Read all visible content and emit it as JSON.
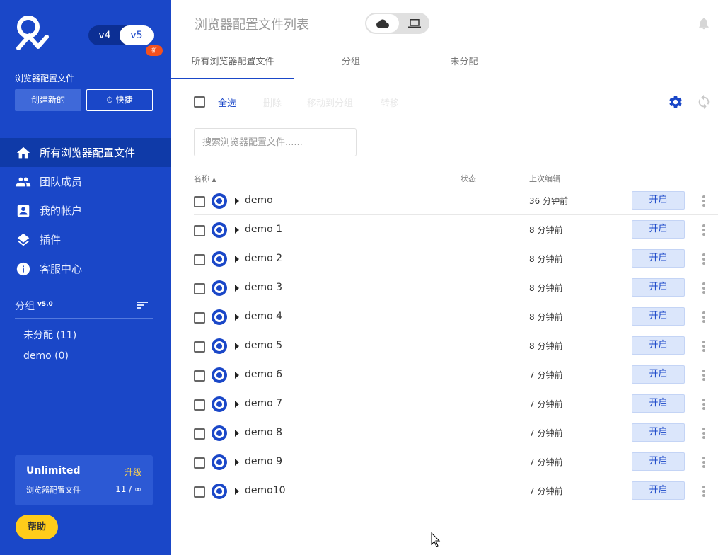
{
  "sidebar": {
    "version": {
      "v4": "v4",
      "v5": "v5",
      "new_badge": "新"
    },
    "profiles_label": "浏览器配置文件",
    "create_button": "创建新的",
    "quick_button": "快捷",
    "nav": [
      {
        "label": "所有浏览器配置文件",
        "icon": "home-icon",
        "active": true
      },
      {
        "label": "团队成员",
        "icon": "team-icon"
      },
      {
        "label": "我的帐户",
        "icon": "account-icon"
      },
      {
        "label": "插件",
        "icon": "layers-icon"
      },
      {
        "label": "客服中心",
        "icon": "info-icon"
      }
    ],
    "groups": {
      "title": "分组",
      "version": "v5.0",
      "items": [
        {
          "label": "未分配 (11)"
        },
        {
          "label": "demo (0)"
        }
      ]
    },
    "plan": {
      "name": "Unlimited",
      "upgrade": "升级",
      "profiles_label": "浏览器配置文件",
      "count": "11 / ∞"
    },
    "help_button": "帮助"
  },
  "header": {
    "title": "浏览器配置文件列表"
  },
  "tabs": [
    {
      "label": "所有浏览器配置文件",
      "active": true
    },
    {
      "label": "分组"
    },
    {
      "label": "未分配"
    }
  ],
  "toolbar": {
    "select_all": "全选",
    "delete": "删除",
    "move_to_group": "移动到分组",
    "transfer": "转移"
  },
  "search": {
    "placeholder": "搜索浏览器配置文件......"
  },
  "table": {
    "columns": {
      "name": "名称",
      "status": "状态",
      "last_edited": "上次编辑"
    },
    "open_label": "开启",
    "rows": [
      {
        "name": "demo",
        "edited": "36 分钟前"
      },
      {
        "name": "demo 1",
        "edited": "8 分钟前"
      },
      {
        "name": "demo 2",
        "edited": "8 分钟前"
      },
      {
        "name": "demo 3",
        "edited": "8 分钟前"
      },
      {
        "name": "demo 4",
        "edited": "8 分钟前"
      },
      {
        "name": "demo 5",
        "edited": "8 分钟前"
      },
      {
        "name": "demo 6",
        "edited": "7 分钟前"
      },
      {
        "name": "demo 7",
        "edited": "7 分钟前"
      },
      {
        "name": "demo 8",
        "edited": "7 分钟前"
      },
      {
        "name": "demo 9",
        "edited": "7 分钟前"
      },
      {
        "name": "demo10",
        "edited": "7 分钟前"
      }
    ]
  },
  "colors": {
    "sidebar_bg": "#1a47c8",
    "accent": "#1a47c8",
    "help_yellow": "#ffcc1a",
    "new_badge": "#f4511e"
  }
}
